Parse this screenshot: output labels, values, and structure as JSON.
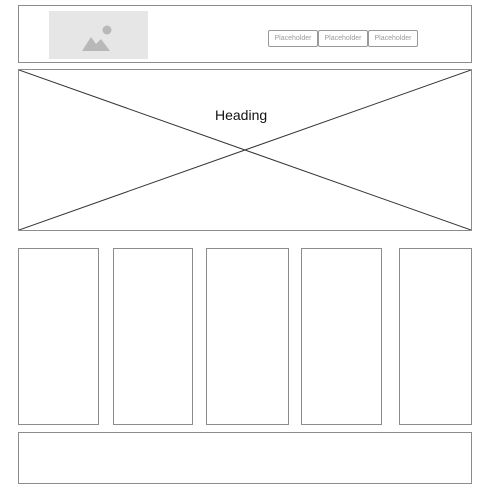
{
  "header": {
    "logo_icon": "image-placeholder-icon",
    "nav_buttons": [
      "Placeholder",
      "Placeholder",
      "Placeholder"
    ]
  },
  "hero": {
    "heading": "Heading",
    "image_icon": "image-placeholder-cross"
  },
  "columns": [
    "",
    "",
    "",
    "",
    ""
  ],
  "footer": {}
}
